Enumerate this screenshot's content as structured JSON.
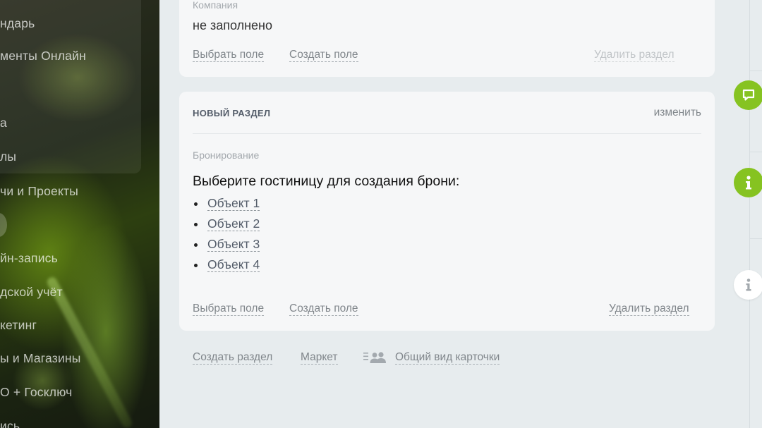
{
  "sidebar": {
    "items": [
      {
        "label": "ндарь"
      },
      {
        "label": "менты Онлайн"
      },
      {
        "label": "а"
      },
      {
        "label": "лы"
      },
      {
        "label": "чи и Проекты"
      },
      {
        "label": "йн-запись"
      },
      {
        "label": "дской учёт"
      },
      {
        "label": "кетинг"
      },
      {
        "label": "ы и Магазины"
      },
      {
        "label": "О + Госключ"
      },
      {
        "label": "ись"
      }
    ]
  },
  "top_card": {
    "field_label": "Компания",
    "field_value": "не заполнено",
    "select_field": "Выбрать поле",
    "create_field": "Создать поле",
    "delete_section": "Удалить раздел"
  },
  "main_card": {
    "section_title": "НОВЫЙ РАЗДЕЛ",
    "edit": "изменить",
    "field_label": "Бронирование",
    "booking_title": "Выберите гостиницу для создания брони:",
    "objects": [
      "Объект 1",
      "Объект 2",
      "Объект 3",
      "Объект 4"
    ],
    "select_field": "Выбрать поле",
    "create_field": "Создать поле",
    "delete_section": "Удалить раздел"
  },
  "bottom_links": {
    "create_section": "Создать раздел",
    "market": "Маркет",
    "card_view": "Общий вид карточки"
  },
  "right_rail": {
    "buttons": [
      {
        "icon": "chat-icon",
        "color": "#86c321"
      },
      {
        "icon": "info-icon",
        "color": "#86c321"
      },
      {
        "icon": "info-icon",
        "color": "#ffffff"
      }
    ]
  }
}
